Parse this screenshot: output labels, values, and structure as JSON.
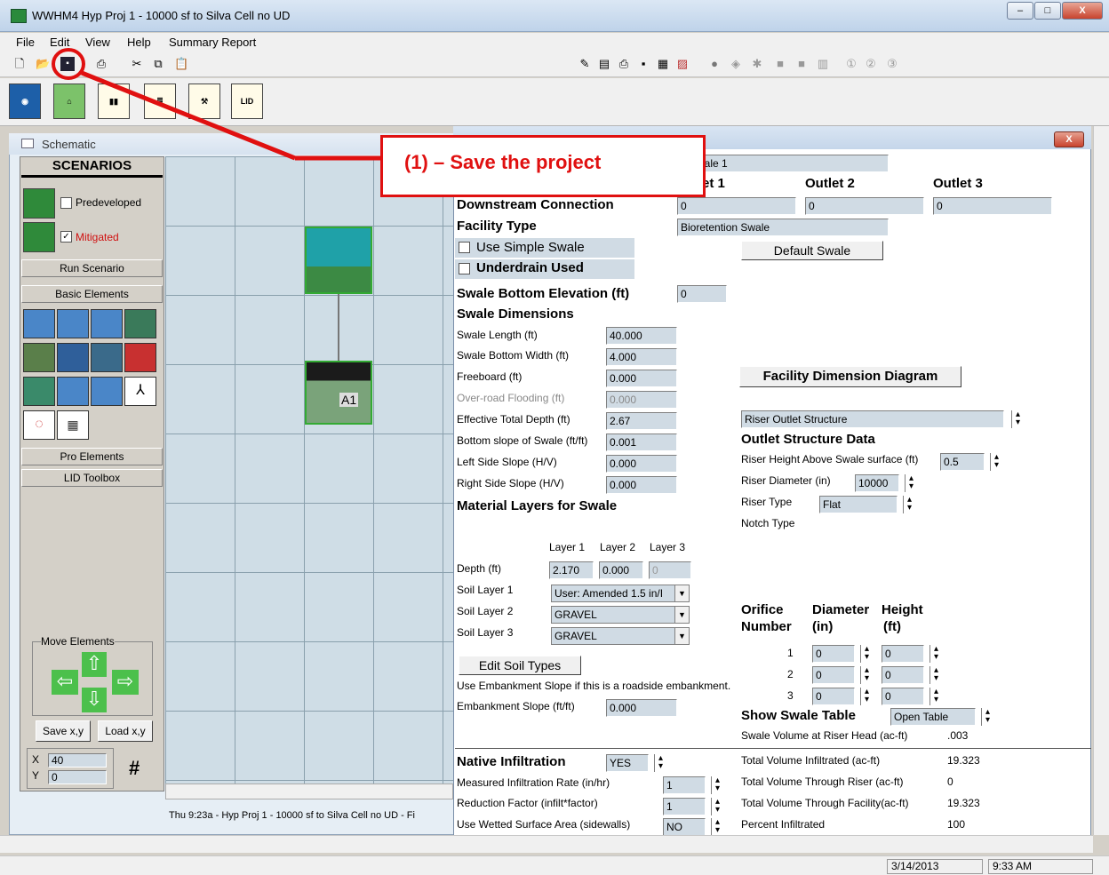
{
  "app": {
    "title": "WWHM4   Hyp Proj 1 - 10000 sf to Silva Cell no UD"
  },
  "window_controls": {
    "minimize": "–",
    "maximize": "□",
    "close": "X"
  },
  "menu": [
    "File",
    "Edit",
    "View",
    "Help",
    "Summary Report"
  ],
  "annotation": {
    "text": "(1) – Save the project"
  },
  "schematic": {
    "title": "Schematic",
    "scenarios_header": "SCENARIOS",
    "predeveloped": "Predeveloped",
    "mitigated": "Mitigated",
    "run_scenario": "Run Scenario",
    "basic_elements": "Basic Elements",
    "pro_elements": "Pro Elements",
    "lid_toolbox": "LID Toolbox",
    "move_elements": "Move Elements",
    "save_xy": "Save x,y",
    "load_xy": "Load x,y",
    "x_label": "X",
    "y_label": "Y",
    "x_value": "40",
    "y_value": "0",
    "grid_icon": "#",
    "element_label": "A1",
    "status_text": "Thu 9:23a - Hyp Proj 1 - 10000 sf to Silva Cell no UD - Fi"
  },
  "facility": {
    "name_value": "wale 1",
    "outlet1": "et 1",
    "outlet2": "Outlet 2",
    "outlet3": "Outlet 3",
    "downstream_label": "Downstream Connection",
    "downstream_values": [
      "0",
      "0",
      "0"
    ],
    "facility_type_label": "Facility Type",
    "facility_type_value": "Bioretention Swale",
    "use_simple_swale": "Use Simple Swale",
    "underdrain_used": "Underdrain Used",
    "default_swale": "Default Swale",
    "bottom_elev_label": "Swale Bottom Elevation (ft)",
    "bottom_elev_value": "0",
    "swale_dimensions": "Swale Dimensions",
    "dims": [
      {
        "label": "Swale Length (ft)",
        "value": "40.000"
      },
      {
        "label": "Swale Bottom Width (ft)",
        "value": "4.000"
      },
      {
        "label": "Freeboard (ft)",
        "value": "0.000"
      },
      {
        "label": "Over-road Flooding (ft)",
        "value": "0.000"
      },
      {
        "label": "Effective Total Depth (ft)",
        "value": "2.67"
      },
      {
        "label": "Bottom slope of Swale (ft/ft)",
        "value": "0.001"
      },
      {
        "label": "Left Side Slope (H/V)",
        "value": "0.000"
      },
      {
        "label": "Right Side Slope (H/V)",
        "value": "0.000"
      }
    ],
    "facility_diagram": "Facility Dimension Diagram",
    "riser_outlet_structure": "Riser Outlet Structure",
    "outlet_structure_data": "Outlet Structure Data",
    "riser_height_label": "Riser Height Above Swale surface (ft)",
    "riser_height_value": "0.5",
    "riser_diameter_label": "Riser Diameter (in)",
    "riser_diameter_value": "10000",
    "riser_type_label": "Riser Type",
    "riser_type_value": "Flat",
    "notch_type_label": "Notch Type",
    "material_layers": "Material Layers for Swale",
    "layer_headers": [
      "Layer 1",
      "Layer 2",
      "Layer 3"
    ],
    "depth_label": "Depth (ft)",
    "depth_values": [
      "2.170",
      "0.000",
      "0"
    ],
    "soil_layers": [
      {
        "label": "Soil Layer 1",
        "value": "User: Amended 1.5 in/I"
      },
      {
        "label": "Soil Layer 2",
        "value": "GRAVEL"
      },
      {
        "label": "Soil Layer 3",
        "value": "GRAVEL"
      }
    ],
    "edit_soil_types": "Edit Soil Types",
    "embankment_note": "Use Embankment Slope if this is a roadside embankment.",
    "embankment_label": "Embankment Slope (ft/ft)",
    "embankment_value": "0.000",
    "orifice_header": "Orifice",
    "number_header": "Number",
    "diameter_header": "Diameter",
    "diameter_unit": "(in)",
    "height_header": "Height",
    "height_unit": "(ft)",
    "orifices": [
      {
        "num": "1",
        "diameter": "0",
        "height": "0"
      },
      {
        "num": "2",
        "diameter": "0",
        "height": "0"
      },
      {
        "num": "3",
        "diameter": "0",
        "height": "0"
      }
    ],
    "show_swale_table": "Show Swale Table",
    "open_table": "Open Table",
    "swale_volume_label": "Swale Volume at Riser Head (ac-ft)",
    "swale_volume_value": ".003",
    "native_infiltration_label": "Native Infiltration",
    "native_infiltration_value": "YES",
    "measured_rate_label": "Measured Infiltration Rate (in/hr)",
    "measured_rate_value": "1",
    "reduction_factor_label": "Reduction Factor (infilt*factor)",
    "reduction_factor_value": "1",
    "wetted_surface_label": "Use Wetted Surface Area (sidewalls)",
    "wetted_surface_value": "NO",
    "results": [
      {
        "label": "Total Volume Infiltrated (ac-ft)",
        "value": "19.323"
      },
      {
        "label": "Total Volume Through Riser (ac-ft)",
        "value": "0"
      },
      {
        "label": "Total Volume Through Facility(ac-ft)",
        "value": "19.323"
      },
      {
        "label": "Percent Infiltrated",
        "value": "100"
      }
    ]
  },
  "statusbar": {
    "date": "3/14/2013",
    "time": "9:33 AM"
  },
  "colors": {
    "annotation": "#e01010",
    "mitigated": "#d01010"
  }
}
